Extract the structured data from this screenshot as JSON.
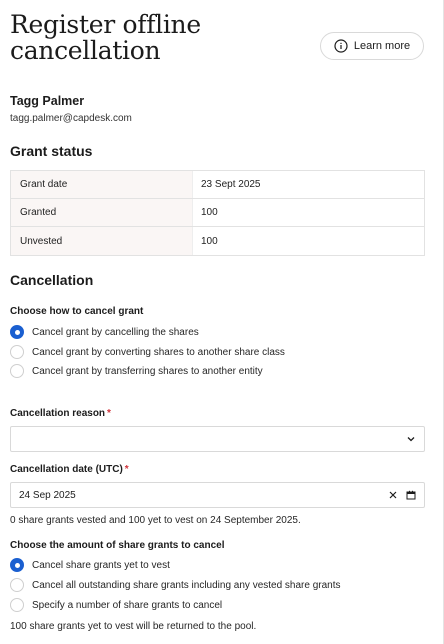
{
  "header": {
    "title": "Register offline cancellation",
    "learn_more_label": "Learn more"
  },
  "user": {
    "name": "Tagg Palmer",
    "email": "tagg.palmer@capdesk.com"
  },
  "grant_status": {
    "heading": "Grant status",
    "rows": [
      {
        "key": "Grant date",
        "value": "23 Sept 2025"
      },
      {
        "key": "Granted",
        "value": "100"
      },
      {
        "key": "Unvested",
        "value": "100"
      }
    ]
  },
  "cancellation": {
    "heading": "Cancellation",
    "method_label": "Choose how to cancel grant",
    "methods": [
      {
        "label": "Cancel grant by cancelling the shares",
        "selected": true
      },
      {
        "label": "Cancel grant by converting shares to another share class",
        "selected": false
      },
      {
        "label": "Cancel grant by transferring shares to another entity",
        "selected": false
      }
    ],
    "reason_label": "Cancellation reason",
    "reason_value": "",
    "date_label": "Cancellation date (UTC)",
    "date_value": "24 Sep 2025",
    "vesting_note": "0 share grants vested and 100 yet to vest on 24 September 2025.",
    "amount_label": "Choose the amount of share grants to cancel",
    "amounts": [
      {
        "label": "Cancel share grants yet to vest",
        "selected": true
      },
      {
        "label": "Cancel all outstanding share grants including any vested share grants",
        "selected": false
      },
      {
        "label": "Specify a number of share grants to cancel",
        "selected": false
      }
    ],
    "pool_note": "100 share grants yet to vest will be returned to the pool."
  },
  "colors": {
    "accent": "#1a5fd0",
    "required": "#d0343c",
    "table_key_bg": "#faf6f5"
  }
}
